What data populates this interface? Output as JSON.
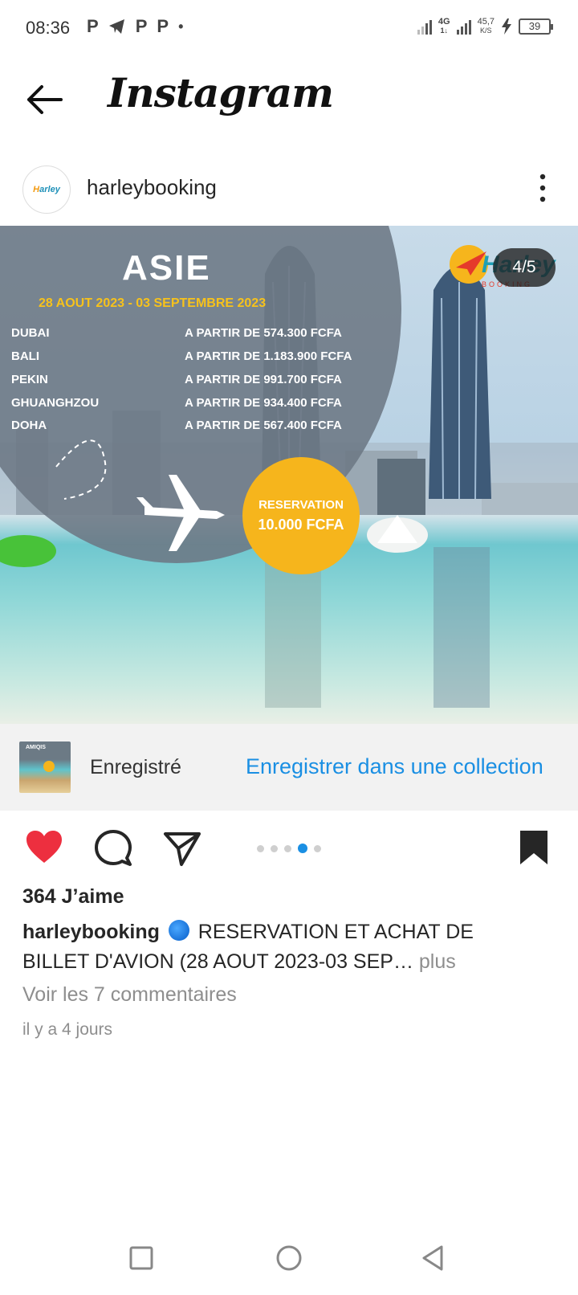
{
  "status_bar": {
    "time": "08:36",
    "notifications": [
      "P",
      "P",
      "P",
      "•"
    ],
    "network": "4G",
    "network_sub": "1↓",
    "speed_value": "45,7",
    "speed_unit": "K/S",
    "battery": "39"
  },
  "header": {
    "title": "Instagram",
    "back_icon": "arrow-left-icon"
  },
  "post": {
    "username": "harleybooking",
    "avatar_text_a": "H",
    "avatar_text_b": "arley",
    "image": {
      "title": "ASIE",
      "dates": "28 AOUT  2023 - 03 SEPTEMBRE 2023",
      "destinations": [
        {
          "city": "DUBAI",
          "price": "A PARTIR DE 574.300  FCFA"
        },
        {
          "city": "BALI",
          "price": "A PARTIR DE 1.183.900 FCFA"
        },
        {
          "city": "PEKIN",
          "price": "A PARTIR DE 991.700 FCFA"
        },
        {
          "city": "GHUANGHZOU",
          "price": "A PARTIR DE 934.400 FCFA"
        },
        {
          "city": "DOHA",
          "price": "A PARTIR DE 567.400 FCFA"
        }
      ],
      "reservation_label": "RESERVATION",
      "reservation_price": "10.000 FCFA",
      "counter": "4/5",
      "logo_text": "Harley",
      "logo_sub": "BOOKING"
    },
    "saved_bar": {
      "thumb_text": "AMIQIS",
      "label": "Enregistré",
      "collection_link": "Enregistrer dans une collection"
    },
    "carousel": {
      "total": 5,
      "active_index": 3
    },
    "likes": "364 J’aime",
    "caption_user": "harleybooking",
    "caption_line1": "RESERVATION ET ACHAT DE",
    "caption_line2": "BILLET D'AVION (28 AOUT 2023-03 SEP…",
    "caption_more": "plus",
    "comments_link": "Voir les 7 commentaires",
    "time_ago": "il y a 4 jours"
  },
  "colors": {
    "like_red": "#ed2f3f",
    "link_blue": "#1a8fe3",
    "reservation_yellow": "#f6b51c",
    "dates_yellow": "#f7c21b"
  }
}
